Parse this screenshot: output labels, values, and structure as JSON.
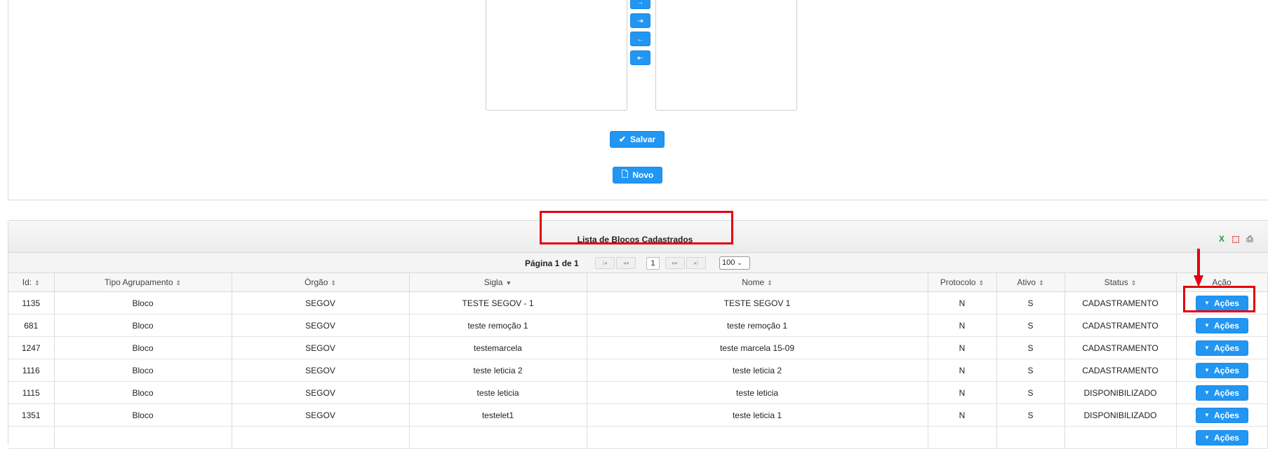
{
  "form": {
    "picklist_buttons": [
      "→",
      "⇥",
      "←",
      "⇤"
    ],
    "save_label": "Salvar",
    "new_label": "Novo"
  },
  "list": {
    "title": "Lista de Blocos Cadastrados",
    "paginator": {
      "label": "Página 1 de 1",
      "current_page": "1",
      "page_size": "100",
      "first": "|◂",
      "prev": "◂◂",
      "next": "▸▸",
      "last": "▸|"
    },
    "columns": [
      "Id:",
      "Tipo Agrupamento",
      "Órgão",
      "Sigla",
      "Nome",
      "Protocolo",
      "Ativo",
      "Status",
      "Ação"
    ],
    "rows": [
      {
        "id": "1135",
        "tipo": "Bloco",
        "orgao": "SEGOV",
        "sigla": "TESTE SEGOV - 1",
        "nome": "TESTE SEGOV 1",
        "protocolo": "N",
        "ativo": "S",
        "status": "CADASTRAMENTO",
        "acao": "Ações"
      },
      {
        "id": "681",
        "tipo": "Bloco",
        "orgao": "SEGOV",
        "sigla": "teste remoção 1",
        "nome": "teste remoção 1",
        "protocolo": "N",
        "ativo": "S",
        "status": "CADASTRAMENTO",
        "acao": "Ações"
      },
      {
        "id": "1247",
        "tipo": "Bloco",
        "orgao": "SEGOV",
        "sigla": "testemarcela",
        "nome": "teste marcela 15-09",
        "protocolo": "N",
        "ativo": "S",
        "status": "CADASTRAMENTO",
        "acao": "Ações"
      },
      {
        "id": "1116",
        "tipo": "Bloco",
        "orgao": "SEGOV",
        "sigla": "teste leticia 2",
        "nome": "teste leticia 2",
        "protocolo": "N",
        "ativo": "S",
        "status": "CADASTRAMENTO",
        "acao": "Ações"
      },
      {
        "id": "1115",
        "tipo": "Bloco",
        "orgao": "SEGOV",
        "sigla": "teste leticia",
        "nome": "teste leticia",
        "protocolo": "N",
        "ativo": "S",
        "status": "DISPONIBILIZADO",
        "acao": "Ações"
      },
      {
        "id": "1351",
        "tipo": "Bloco",
        "orgao": "SEGOV",
        "sigla": "testelet1",
        "nome": "teste leticia 1",
        "protocolo": "N",
        "ativo": "S",
        "status": "DISPONIBILIZADO",
        "acao": "Ações"
      },
      {
        "id": "",
        "tipo": "",
        "orgao": "",
        "sigla": "",
        "nome": "",
        "protocolo": "",
        "ativo": "",
        "status": "",
        "acao": "Ações"
      }
    ]
  },
  "colors": {
    "primary": "#2196f3",
    "highlight": "#e3000f"
  },
  "icons": [
    "check-icon",
    "document-icon",
    "sort-icon",
    "caret-down-icon",
    "excel-export-icon",
    "pdf-export-icon",
    "print-icon"
  ]
}
